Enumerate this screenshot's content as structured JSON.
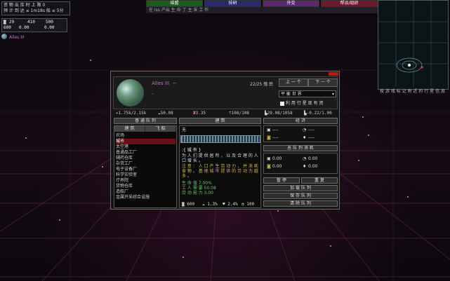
{
  "hud": {
    "info_line1": "资 物 出 库 时 上 限 0",
    "info_line2": "预 计 到 达 ≤ 1m18s 船 ≤ 5分",
    "res_a": "29",
    "res_b": "410",
    "res_c": "500",
    "res_d": "600",
    "res_e": "0.00",
    "res_f": "0.00",
    "planet_label": "Alles III",
    "top_buttons": [
      "结盟",
      "技研",
      "外交",
      "帮派/组织"
    ],
    "ticker": "在 Iss 产出 生 命 了 主 采 工 作",
    "minimap_label": "按 游 戏 标 记 附 近 的 行 星 信 息"
  },
  "colors": {
    "accent": "#d55fd8",
    "active_row": "#6a0f16",
    "close": "#cc1111"
  },
  "dialog": {
    "planet_name": "Alles III",
    "planet_tag": "--",
    "population": "22/25 殖 民",
    "prev_label": "上 一 个",
    "next_label": "下 一 个",
    "select_value": "平 衡 世 界",
    "checkbox_label": "利 用 行 星 现 有 资",
    "stats": [
      "1.75k/2.15k",
      "50.08",
      "23.35",
      "108/108",
      "29.08/1058",
      "-0.22/1.00"
    ],
    "queue_title": "普 通 队 列",
    "build_title": "建 筑",
    "economy_title": "经 济",
    "tab_build": "建 筑",
    "tab_ship": "飞 船",
    "list": [
      "农场",
      "城市",
      "太空港",
      "普通品工厂",
      "辅药仓库",
      "杂货工厂",
      "电子设备厂",
      "科学实验室",
      "疗养院",
      "货物仓库",
      "造船厂",
      "金属开采综合设施"
    ],
    "selected_index": 1,
    "detail_title": "无",
    "detail_name": "城 市",
    "detail_desc": "为 人 们 提 供 居 所 ， 以 及 合 理 的 人 口 增 长 。",
    "detail_note": "注 意 ： 人 口 产 生 劳 动 力 ， 并 消 耗 食 物 。 基 地 城 市 提 供 的 劳 动 力 越 多 。",
    "detail_line1": "生 命 值 7.00%",
    "detail_line2": "工 人 需 要 50.08",
    "detail_line3": "劳 动 能 力 3.00",
    "detail_footer": [
      "600",
      "1.3%",
      "2.4%",
      "100"
    ],
    "econ_dash1": "----",
    "econ_dash2": "----",
    "econ_dash3": "----",
    "econ_dash4": "----",
    "queue_econ_title": "总 队 列 消 耗",
    "queue_vals": [
      "0.00",
      "0.00",
      "0.00",
      "0.00"
    ],
    "pause_label": "暂 停",
    "repeat_label": "重 复",
    "btn_add_queue": "加 载 队 列",
    "btn_save_queue": "保 存 队 列",
    "btn_clear_queue": "清 除 队 列"
  }
}
